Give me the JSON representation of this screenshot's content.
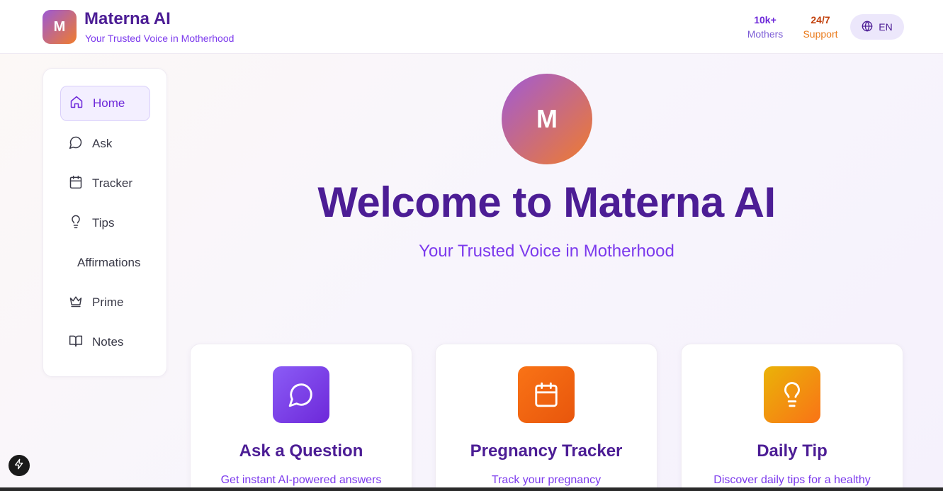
{
  "header": {
    "logo_letter": "M",
    "brand_title": "Materna AI",
    "brand_subtitle": "Your Trusted Voice in Motherhood",
    "stats": [
      {
        "value": "10k+",
        "label": "Mothers"
      },
      {
        "value": "24/7",
        "label": "Support"
      }
    ],
    "language": {
      "label": "EN",
      "icon": "globe-icon"
    }
  },
  "sidebar": {
    "items": [
      {
        "label": "Home",
        "icon": "home-icon",
        "active": true
      },
      {
        "label": "Ask",
        "icon": "chat-bubble-icon"
      },
      {
        "label": "Tracker",
        "icon": "calendar-icon"
      },
      {
        "label": "Tips",
        "icon": "lightbulb-icon"
      },
      {
        "label": "Affirmations",
        "icon": ""
      },
      {
        "label": "Prime",
        "icon": "crown-icon"
      },
      {
        "label": "Notes",
        "icon": "book-icon"
      }
    ]
  },
  "hero": {
    "avatar_letter": "M",
    "title": "Welcome to Materna AI",
    "subtitle": "Your Trusted Voice in Motherhood"
  },
  "cards": [
    {
      "title": "Ask a Question",
      "description": "Get instant AI-powered answers",
      "icon": "chat-bubble-icon",
      "color": "#7c3aed"
    },
    {
      "title": "Pregnancy Tracker",
      "description": "Track your pregnancy",
      "icon": "calendar-icon",
      "color": "#f97316"
    },
    {
      "title": "Daily Tip",
      "description": "Discover daily tips for a healthy",
      "icon": "lightbulb-icon",
      "color": "#eab308"
    }
  ],
  "colors": {
    "brand_dark": "#4c1d95",
    "brand_purple": "#7c3aed",
    "accent_orange": "#f97316"
  }
}
